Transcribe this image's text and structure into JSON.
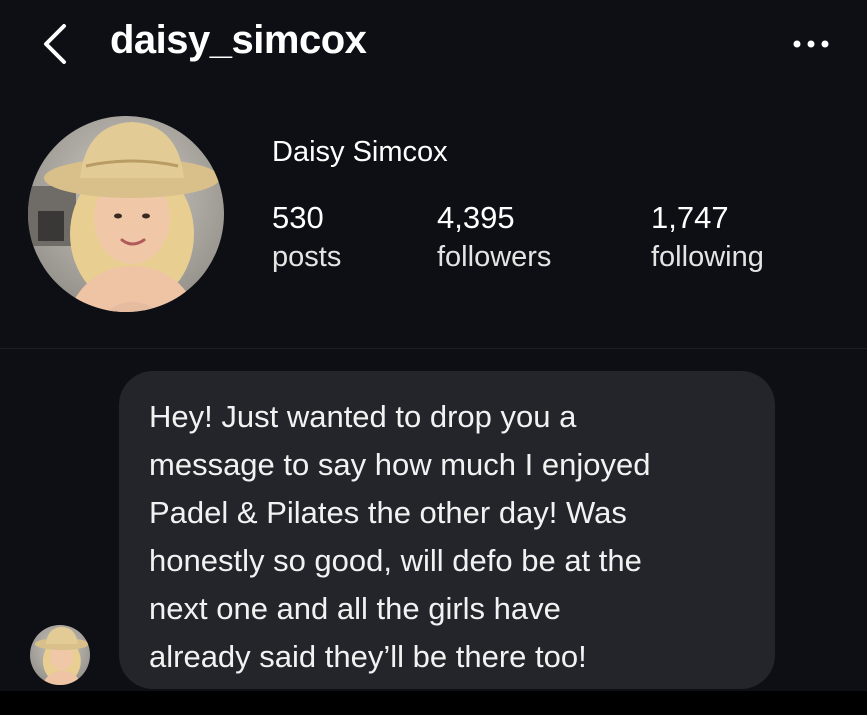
{
  "header": {
    "username": "daisy_simcox",
    "back_icon": "chevron-left-icon",
    "more_icon": "more-horizontal-icon"
  },
  "profile": {
    "display_name": "Daisy Simcox",
    "stats": [
      {
        "value": "530",
        "label": "posts"
      },
      {
        "value": "4,395",
        "label": "followers"
      },
      {
        "value": "1,747",
        "label": "following"
      }
    ]
  },
  "message": {
    "text": "Hey! Just wanted to drop you a\nmessage to say how much I enjoyed\nPadel & Pilates the other day! Was\nhonestly so good, will defo be at the\nnext one and all the girls have\nalready said they’ll be there too!"
  },
  "colors": {
    "background": "#0d0f14",
    "bubble": "#23252b",
    "text": "#ffffff"
  }
}
